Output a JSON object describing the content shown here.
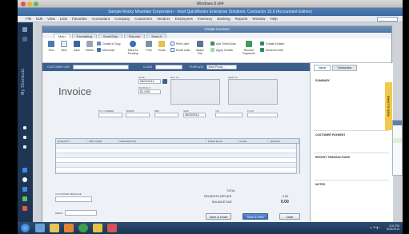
{
  "mac": {
    "title": "Windows 8 x64"
  },
  "app": {
    "title": "Sample Rocky Mountain Corporation - Intuit QuickBooks Enterprise Solutions: Contractor 15.0 (Accountant Edition)",
    "menu": [
      "File",
      "Edit",
      "View",
      "Lists",
      "Favorites",
      "Accountant",
      "Company",
      "Customers",
      "Vendors",
      "Employees",
      "Inventory",
      "Banking",
      "Reports",
      "Window",
      "Help"
    ],
    "sidebar_label": "My Shortcuts"
  },
  "window": {
    "title": "Create Invoices",
    "tabs": [
      "Main",
      "Formatting",
      "Send/Ship",
      "Reports",
      "Search"
    ],
    "ribbon": {
      "find": "Find",
      "new": "New",
      "save": "Save",
      "delete": "Delete",
      "create_copy": "Create a Copy",
      "memorize": "Memorize",
      "mark_pending": "Mark As Pending",
      "print": "Print",
      "email": "Email",
      "print_later": "Print Later",
      "email_later": "Email Later",
      "attach_file": "Attach File",
      "add_time_costs": "Add Time/Costs",
      "apply_credits": "Apply Credits",
      "receive_payments": "Receive Payments",
      "create_batch": "Create a Batch",
      "refund_credit": "Refund/Credit"
    }
  },
  "customer_bar": {
    "customer_job_label": "CUSTOMER:JOB",
    "class_label": "CLASS",
    "template_label": "TEMPLATE",
    "template_value": "Intuit Produ..."
  },
  "form": {
    "title": "Invoice",
    "date_label": "DATE",
    "date_value": "08/23/2014",
    "invoice_no_label": "INVOICE #",
    "invoice_no_value": "81-1001",
    "bill_to_label": "BILL TO",
    "ship_to_label": "SHIP TO",
    "po_label": "P.O. NUMBER",
    "terms_label": "TERMS",
    "rep_label": "REP",
    "ship_label": "SHIP",
    "ship_value": "08/23/2014",
    "via_label": "VIA",
    "fob_label": "F.O.B.",
    "columns": [
      "QUANTITY",
      "ITEM CODE",
      "DESCRIPTION",
      "PRICE EACH",
      "CLASS",
      "AMOUNT"
    ],
    "customer_message_label": "CUSTOMER MESSAGE",
    "memo_label": "MEMO",
    "total_label": "TOTAL",
    "payments_applied_label": "PAYMENTS APPLIED",
    "balance_due_label": "BALANCE DUE",
    "payments_applied_value": "0.00",
    "balance_due_value": "0.00",
    "save_close": "Save & Close",
    "save_new": "Save & New",
    "clear": "Clear"
  },
  "right_panel": {
    "tabs": [
      "Name",
      "Transaction"
    ],
    "sections": [
      "SUMMARY",
      "CUSTOMER PAYMENT",
      "RECENT TRANSACTIONS",
      "NOTES"
    ]
  },
  "whats_new": "WHAT'S NEW",
  "taskbar": {
    "time": "4:31 PM",
    "date": "8/23/2014",
    "tray": "▲ ⚑ ▮ ♪"
  },
  "colors": {
    "title_blue": "#3b6aa3",
    "sidebar_navy": "#1f3554",
    "primary_button": "#3b6fb5",
    "whats_new_yellow": "#f2c94c"
  }
}
